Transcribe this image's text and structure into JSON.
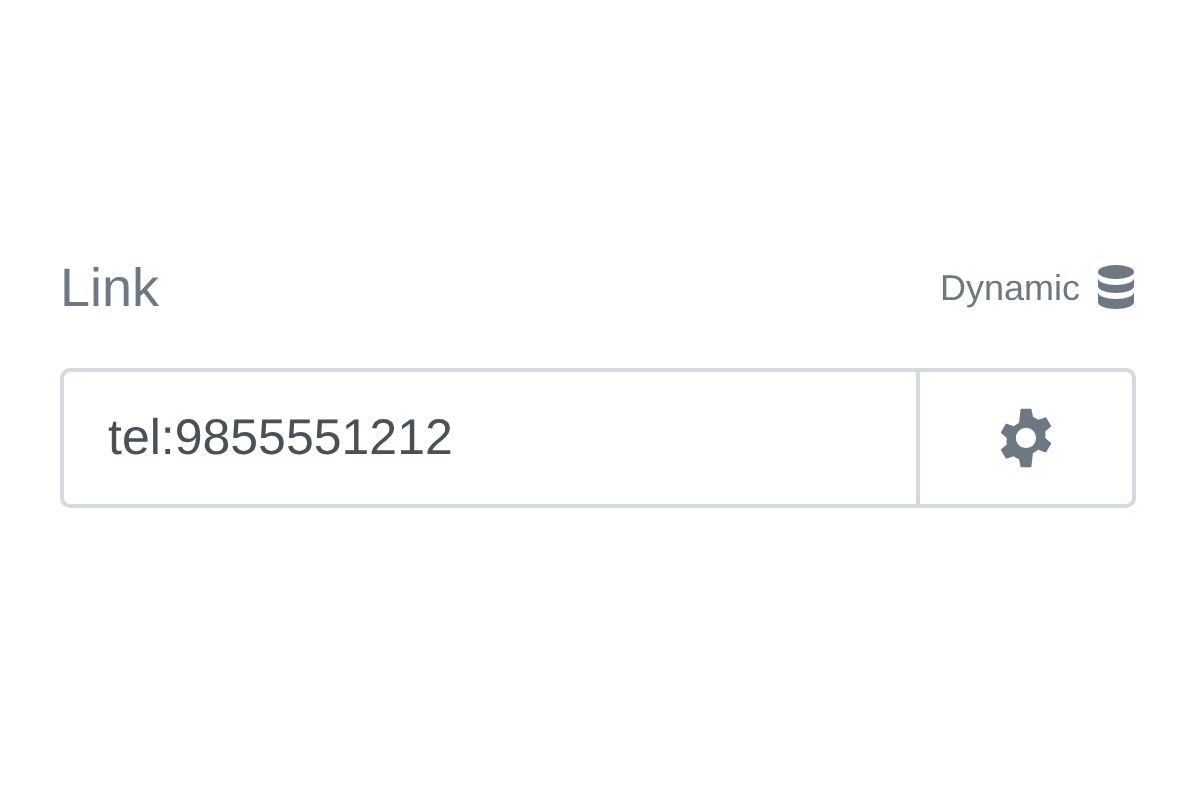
{
  "control": {
    "label": "Link",
    "dynamic": {
      "label": "Dynamic"
    },
    "field": {
      "value": "tel:9855551212"
    }
  }
}
